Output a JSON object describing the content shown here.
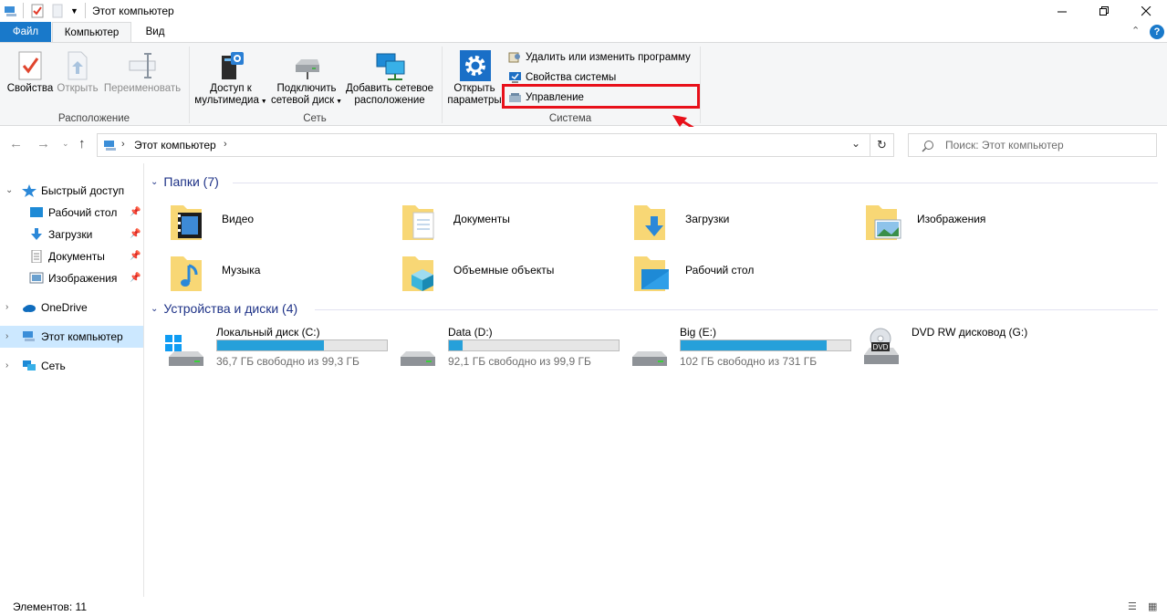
{
  "window": {
    "title": "Этот компьютер",
    "controls": [
      "minimize",
      "restore",
      "close"
    ]
  },
  "ribbon_tabs": {
    "file": "Файл",
    "computer": "Компьютер",
    "view": "Вид"
  },
  "ribbon": {
    "location_group": {
      "label": "Расположение",
      "properties": "Свойства",
      "open": "Открыть",
      "rename": "Переименовать"
    },
    "network_group": {
      "label": "Сеть",
      "media_line1": "Доступ к",
      "media_line2": "мультимедиа",
      "map_drive_line1": "Подключить",
      "map_drive_line2": "сетевой диск",
      "add_location_line1": "Добавить сетевое",
      "add_location_line2": "расположение"
    },
    "system_group": {
      "label": "Система",
      "open_settings_line1": "Открыть",
      "open_settings_line2": "параметры",
      "uninstall": "Удалить или изменить программу",
      "system_properties": "Свойства системы",
      "manage": "Управление"
    }
  },
  "address_bar": {
    "path": "Этот компьютер",
    "search_placeholder": "Поиск: Этот компьютер"
  },
  "sidebar": {
    "quick_access": "Быстрый доступ",
    "pinned": [
      "Рабочий стол",
      "Загрузки",
      "Документы",
      "Изображения"
    ],
    "onedrive": "OneDrive",
    "this_pc": "Этот компьютер",
    "network": "Сеть"
  },
  "folders_section": {
    "title": "Папки (7)",
    "items": [
      "Видео",
      "Документы",
      "Загрузки",
      "Изображения",
      "Музыка",
      "Объемные объекты",
      "Рабочий стол"
    ]
  },
  "devices_section": {
    "title": "Устройства и диски (4)",
    "drives": [
      {
        "name": "Локальный диск (C:)",
        "free": "36,7 ГБ свободно из 99,3 ГБ",
        "used_fraction": 0.63
      },
      {
        "name": "Data (D:)",
        "free": "92,1 ГБ свободно из 99,9 ГБ",
        "used_fraction": 0.08
      },
      {
        "name": "Big (E:)",
        "free": "102 ГБ свободно из 731 ГБ",
        "used_fraction": 0.86
      },
      {
        "name": "DVD RW дисковод (G:)"
      }
    ]
  },
  "status": {
    "items_count": "Элементов: 11"
  },
  "colors": {
    "accent": "#1979ca",
    "drive_fill": "#26a0da",
    "highlight": "#e8101a",
    "folder": "#f8d775",
    "selected": "#cce8ff"
  }
}
